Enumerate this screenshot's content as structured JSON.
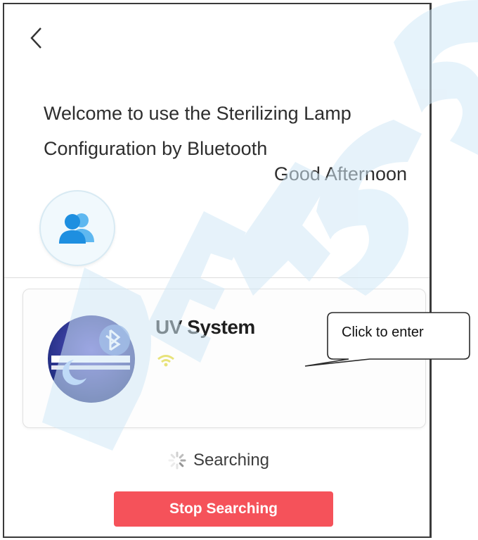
{
  "header": {
    "back_icon": "chevron-left-icon"
  },
  "welcome": {
    "line1": "Welcome to use the Sterilizing Lamp",
    "line2": "Configuration by Bluetooth",
    "greeting": "Good Afternoon"
  },
  "profile": {
    "icon": "users-icon"
  },
  "device": {
    "name": "UV System",
    "icon": "bluetooth-uv-lamp-icon",
    "signal_icon": "wifi-signal-icon"
  },
  "annotation": {
    "callout_text": "Click to enter"
  },
  "status": {
    "label": "Searching",
    "icon": "spinner-icon"
  },
  "actions": {
    "stop_label": "Stop Searching"
  },
  "colors": {
    "accent_red": "#f5525a",
    "accent_blue": "#1e9be8",
    "device_bg": "#27348b",
    "watermark": "#d7ecf8"
  }
}
